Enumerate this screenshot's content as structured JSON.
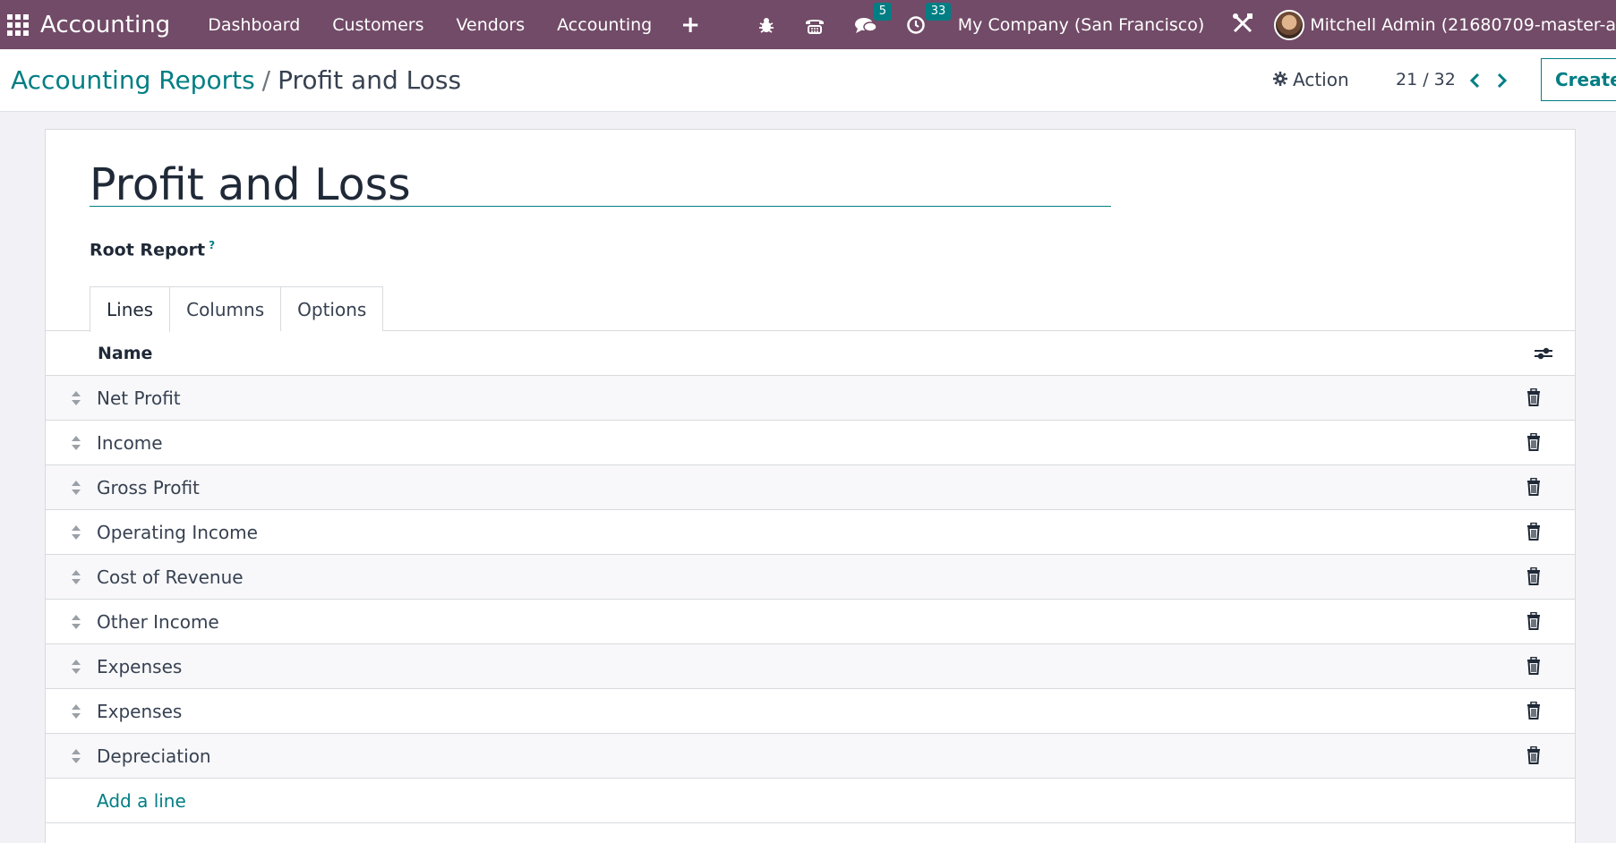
{
  "navbar": {
    "brand": "Accounting",
    "menu": [
      "Dashboard",
      "Customers",
      "Vendors",
      "Accounting"
    ],
    "messages_count": "5",
    "activities_count": "33",
    "company": "My Company (San Francisco)",
    "user": "Mitchell Admin (21680709-master-a"
  },
  "control": {
    "breadcrumb_parent": "Accounting Reports",
    "breadcrumb_sep": "/",
    "breadcrumb_current": "Profit and Loss",
    "action_label": "Action",
    "pager": "21 / 32",
    "create_label": "Create"
  },
  "form": {
    "title": "Profit and Loss",
    "root_report_label": "Root Report",
    "root_report_help": "?",
    "tabs": [
      "Lines",
      "Columns",
      "Options"
    ],
    "active_tab": "Lines",
    "column_header": "Name",
    "lines": [
      "Net Profit",
      "Income",
      "Gross Profit",
      "Operating Income",
      "Cost of Revenue",
      "Other Income",
      "Expenses",
      "Expenses",
      "Depreciation"
    ],
    "add_line": "Add a line"
  },
  "colors": {
    "navbar": "#714b67",
    "accent": "#017e84"
  }
}
